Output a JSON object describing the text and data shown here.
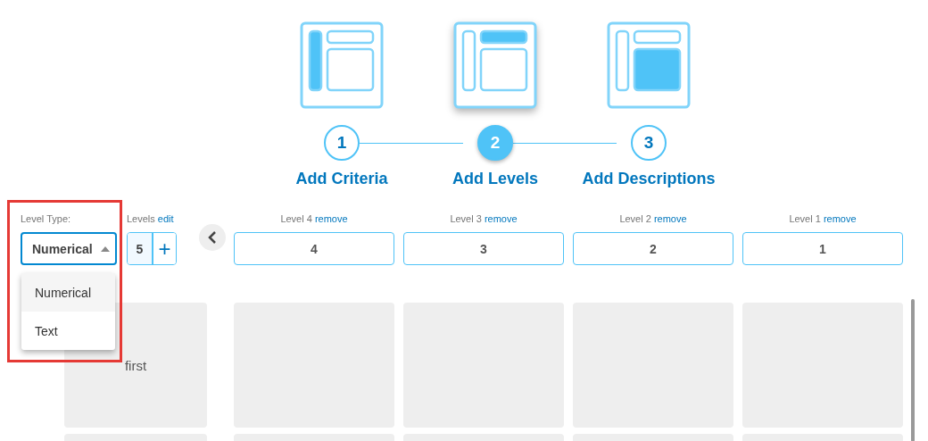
{
  "steps": [
    {
      "number": "1",
      "label": "Add Criteria",
      "selected": false,
      "kind": "sidebar"
    },
    {
      "number": "2",
      "label": "Add Levels",
      "selected": true,
      "kind": "header"
    },
    {
      "number": "3",
      "label": "Add Descriptions",
      "selected": false,
      "kind": "body"
    }
  ],
  "level_type": {
    "label": "Level Type:",
    "value": "Numerical",
    "expanded": true,
    "options": [
      {
        "label": "Numerical",
        "selected": true
      },
      {
        "label": "Text",
        "selected": false
      }
    ]
  },
  "levels": {
    "label": "Levels",
    "link": "edit",
    "count": "5",
    "add": "+"
  },
  "columns": [
    {
      "label": "Level 4",
      "link": "remove",
      "value": "4"
    },
    {
      "label": "Level 3",
      "link": "remove",
      "value": "3"
    },
    {
      "label": "Level 2",
      "link": "remove",
      "value": "2"
    },
    {
      "label": "Level 1",
      "link": "remove",
      "value": "1"
    }
  ],
  "criteria": [
    {
      "label": "first"
    }
  ]
}
